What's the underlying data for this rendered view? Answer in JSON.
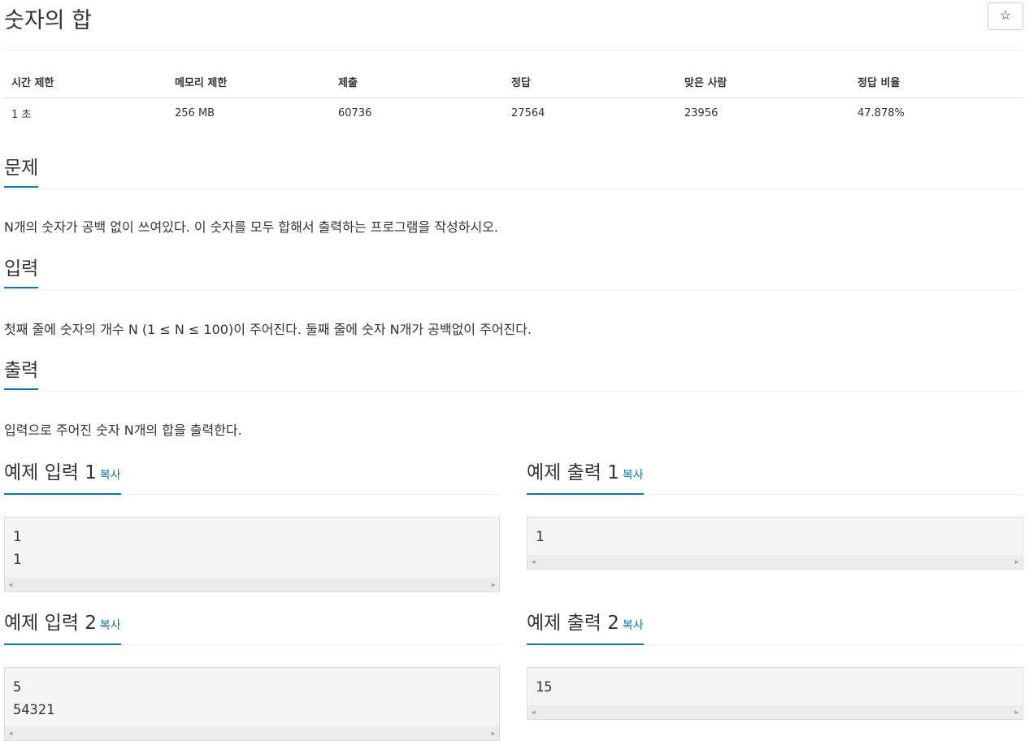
{
  "problem": {
    "title": "숫자의 합",
    "star_label": "☆"
  },
  "info": {
    "headers": [
      "시간 제한",
      "메모리 제한",
      "제출",
      "정답",
      "맞은 사람",
      "정답 비율"
    ],
    "values": [
      "1 초",
      "256 MB",
      "60736",
      "27564",
      "23956",
      "47.878%"
    ]
  },
  "sections": {
    "description": {
      "heading": "문제",
      "text": "N개의 숫자가 공백 없이 쓰여있다. 이 숫자를 모두 합해서 출력하는 프로그램을 작성하시오."
    },
    "input": {
      "heading": "입력",
      "text": "첫째 줄에 숫자의 개수 N (1 ≤ N ≤ 100)이 주어진다. 둘째 줄에 숫자 N개가 공백없이 주어진다."
    },
    "output": {
      "heading": "출력",
      "text": "입력으로 주어진 숫자 N개의 합을 출력한다."
    }
  },
  "samples": {
    "copy_label": "복사",
    "input_1": {
      "heading": "예제 입력 1",
      "content": "1\n1"
    },
    "output_1": {
      "heading": "예제 출력 1",
      "content": "1"
    },
    "input_2": {
      "heading": "예제 입력 2",
      "content": "5\n54321"
    },
    "output_2": {
      "heading": "예제 출력 2",
      "content": "15"
    }
  },
  "colors": {
    "accent": "#0e76a8",
    "sample_bg": "#f5f5f5"
  }
}
